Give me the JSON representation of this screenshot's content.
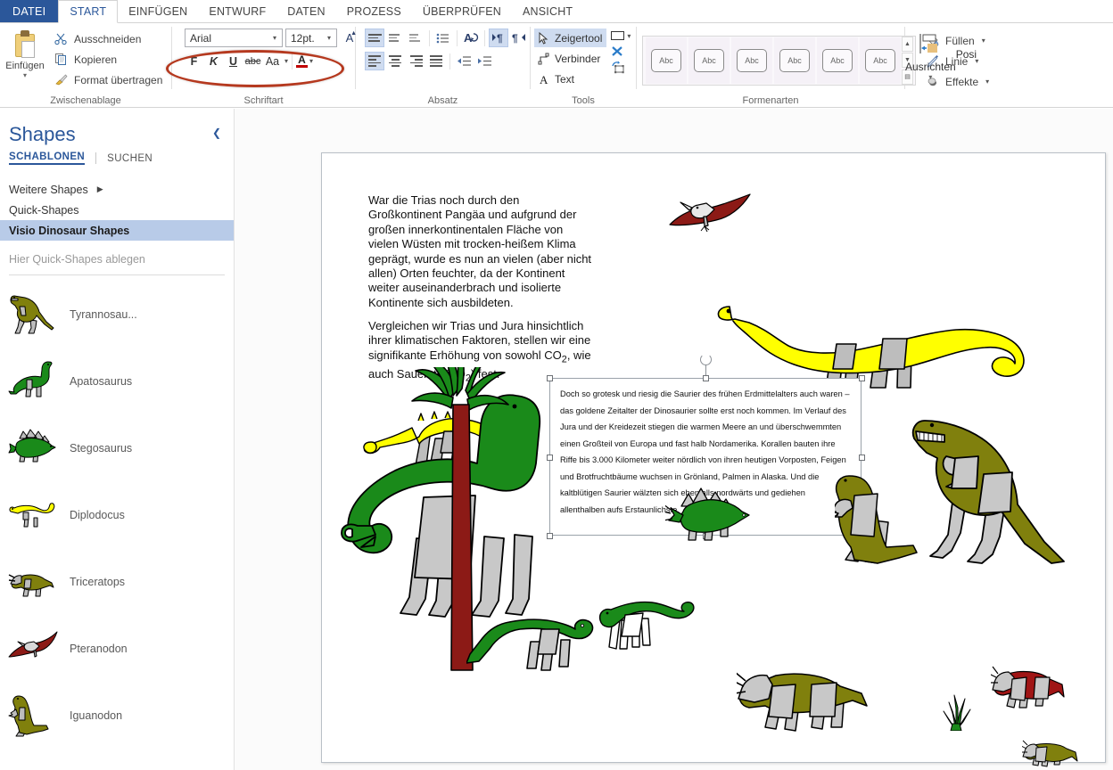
{
  "app": {
    "tabs": [
      {
        "label": "DATEI",
        "kind": "file"
      },
      {
        "label": "START",
        "kind": "active"
      },
      {
        "label": "EINFÜGEN",
        "kind": "normal"
      },
      {
        "label": "ENTWURF",
        "kind": "normal"
      },
      {
        "label": "DATEN",
        "kind": "normal"
      },
      {
        "label": "PROZESS",
        "kind": "normal"
      },
      {
        "label": "ÜBERPRÜFEN",
        "kind": "normal"
      },
      {
        "label": "ANSICHT",
        "kind": "normal"
      }
    ]
  },
  "ribbon": {
    "clipboard": {
      "group_label": "Zwischenablage",
      "paste_label": "Einfügen",
      "cut_label": "Ausschneiden",
      "copy_label": "Kopieren",
      "format_painter_label": "Format übertragen"
    },
    "font": {
      "group_label": "Schriftart",
      "font_name": "Arial",
      "font_size": "12pt.",
      "bold": "F",
      "italic": "K",
      "underline": "U",
      "strike": "abc",
      "change_case": "Aa",
      "font_color_letter": "A",
      "font_color_hex": "#c00000",
      "grow_font": "A",
      "shrink_font": "A"
    },
    "paragraph": {
      "group_label": "Absatz"
    },
    "tools": {
      "group_label": "Tools",
      "pointer_label": "Zeigertool",
      "connector_label": "Verbinder",
      "text_label": "Text"
    },
    "shape_styles": {
      "group_label": "Formenarten",
      "thumb_label": "Abc",
      "thumb_count": 6,
      "fill_label": "Füllen",
      "line_label": "Linie",
      "effects_label": "Effekte",
      "fill_accent_hex": "#a300c8"
    },
    "arrange": {
      "align_label": "Ausrichten",
      "position_label": "Posi"
    }
  },
  "shapes_panel": {
    "title": "Shapes",
    "tab_stencils": "SCHABLONEN",
    "tab_search": "SUCHEN",
    "more_shapes": "Weitere Shapes",
    "quick_shapes": "Quick-Shapes",
    "active_stencil": "Visio Dinosaur Shapes",
    "drop_hint": "Hier Quick-Shapes ablegen",
    "items": [
      {
        "label": "Tyrannosau...",
        "icon": "tyrannosaurus-thumb"
      },
      {
        "label": "Apatosaurus",
        "icon": "apatosaurus-thumb"
      },
      {
        "label": "Stegosaurus",
        "icon": "stegosaurus-thumb"
      },
      {
        "label": "Diplodocus",
        "icon": "diplodocus-thumb"
      },
      {
        "label": "Triceratops",
        "icon": "triceratops-thumb"
      },
      {
        "label": "Pteranodon",
        "icon": "pteranodon-thumb"
      },
      {
        "label": "Iguanodon",
        "icon": "iguanodon-thumb"
      }
    ]
  },
  "canvas": {
    "text_block_1": "War die Trias noch durch den Großkontinent Pangäa und aufgrund der großen innerkontinentalen Fläche von vielen Wüsten mit trocken-heißem Klima geprägt, wurde es nun an vielen (aber nicht allen) Orten feuchter, da der Kontinent weiter auseinanderbrach und isolierte Kontinente sich ausbildeten.",
    "text_block_2_pre": "Vergleichen wir Trias und Jura hinsichtlich ihrer klimatischen Faktoren, stellen wir eine signifikante Erhöhung von sowohl CO",
    "text_block_2_sub1": "2",
    "text_block_2_mid": ", wie auch Sauerstoff (O",
    "text_block_2_sub2": "2",
    "text_block_2_post": ") fest.",
    "selected_shape_text": "Doch so grotesk und riesig die Saurier des frühen Erdmittelalters auch waren – das goldene Zeitalter der Dinosaurier sollte erst noch kommen. Im Verlauf des Jura und der Kreidezeit stiegen die warmen Meere an und überschwemmten einen Großteil von Europa und fast halb Nordamerika. Korallen bauten ihre Riffe bis 3.000 Kilometer weiter nördlich von ihren heutigen Vorposten, Feigen und Brotfruchtbäume wuchsen in Grönland, Palmen in Alaska. Und die kaltblütigen Saurier wälzten sich ebenfalls nordwärts und gediehen allenthalben aufs Erstaunlichste.",
    "figures": [
      {
        "name": "pteranodon",
        "color": "#8c1a16"
      },
      {
        "name": "apatosaurus-yellow",
        "color": "#ffff00"
      },
      {
        "name": "ankylosaurus-yellow",
        "color": "#ffff00"
      },
      {
        "name": "tyrannosaurus-olive",
        "color": "#80800d"
      },
      {
        "name": "apatosaurus-green",
        "color": "#1a8a1a"
      },
      {
        "name": "palm-tree",
        "color": "#8c1a16"
      },
      {
        "name": "hadrosaur-green",
        "color": "#1a8a1a"
      },
      {
        "name": "stegosaurus-green",
        "color": "#1a8a1a"
      },
      {
        "name": "iguanodon-olive",
        "color": "#80800d"
      },
      {
        "name": "diplodocus-green",
        "color": "#1a8a1a"
      },
      {
        "name": "triceratops-olive",
        "color": "#80800d"
      },
      {
        "name": "grass-tuft",
        "color": "#1a8a1a"
      },
      {
        "name": "triceratops-red",
        "color": "#a01515"
      },
      {
        "name": "triceratops-small-olive",
        "color": "#80800d"
      }
    ]
  },
  "colors": {
    "accent_blue": "#2b579a",
    "annotation_red": "#b5391f",
    "selection_blue": "#b8cbe8",
    "olive": "#80800d",
    "green": "#1a8a1a",
    "gray_body": "#c0c0c0",
    "dark_red": "#8c1a16"
  }
}
